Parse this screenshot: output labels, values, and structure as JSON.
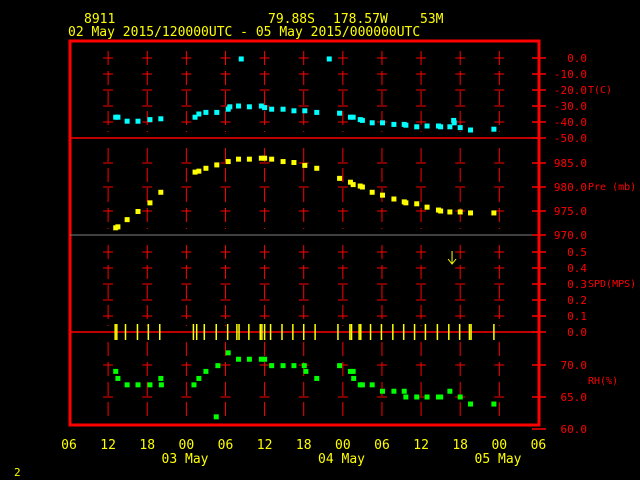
{
  "header": {
    "station": "8911",
    "latitude": "79.88S",
    "longitude": "178.57W",
    "elevation": "53M",
    "period": "02 May 2015/120000UTC - 05 May 2015/000000UTC"
  },
  "footer_label": "2",
  "colors": {
    "frame": "#ff0000",
    "axis_text": "#ffff00",
    "temperature": "#00ffff",
    "pressure": "#ffff00",
    "wind": "#ffff00",
    "humidity": "#00ff00"
  },
  "chart_data": {
    "type": "scatter",
    "x_axis": {
      "range": [
        "2015-05-02T06:00",
        "2015-05-05T06:00"
      ],
      "tick_labels": [
        "06",
        "12",
        "18",
        "00",
        "06",
        "12",
        "18",
        "00",
        "06",
        "12",
        "18",
        "00",
        "06"
      ],
      "date_labels": [
        "03 May",
        "04 May",
        "05 May"
      ],
      "grid": true
    },
    "panels": [
      {
        "key": "temperature",
        "ylabel": "T(C)",
        "ylim": [
          -50,
          0
        ],
        "tick_labels": [
          "0.0",
          "-10.0",
          "-20.0",
          "-30.0",
          "-40.0",
          "-50.0"
        ],
        "points": [
          [
            "2015-05-02T13:10",
            -37
          ],
          [
            "2015-05-02T13:30",
            -37
          ],
          [
            "2015-05-02T14:55",
            -39.5
          ],
          [
            "2015-05-02T16:35",
            -39.5
          ],
          [
            "2015-05-02T18:25",
            -38.5
          ],
          [
            "2015-05-02T20:05",
            -38
          ],
          [
            "2015-05-03T01:20",
            -37
          ],
          [
            "2015-05-03T01:55",
            -35
          ],
          [
            "2015-05-03T03:00",
            -34
          ],
          [
            "2015-05-03T04:40",
            -34
          ],
          [
            "2015-05-03T06:25",
            -32
          ],
          [
            "2015-05-03T06:40",
            -30.5
          ],
          [
            "2015-05-03T08:00",
            -30
          ],
          [
            "2015-05-03T08:25",
            -0.6
          ],
          [
            "2015-05-03T09:40",
            -30.5
          ],
          [
            "2015-05-03T11:30",
            -30
          ],
          [
            "2015-05-03T12:00",
            -31
          ],
          [
            "2015-05-03T13:05",
            -32
          ],
          [
            "2015-05-03T14:50",
            -32
          ],
          [
            "2015-05-03T16:30",
            -33
          ],
          [
            "2015-05-03T18:10",
            -33
          ],
          [
            "2015-05-03T20:00",
            -34
          ],
          [
            "2015-05-03T21:55",
            -0.6
          ],
          [
            "2015-05-03T23:30",
            -34.5
          ],
          [
            "2015-05-04T01:10",
            -37
          ],
          [
            "2015-05-04T01:35",
            -37
          ],
          [
            "2015-05-04T02:40",
            -38.5
          ],
          [
            "2015-05-04T03:00",
            -39
          ],
          [
            "2015-05-04T04:30",
            -40.5
          ],
          [
            "2015-05-04T06:05",
            -40.5
          ],
          [
            "2015-05-04T07:50",
            -41.5
          ],
          [
            "2015-05-04T09:25",
            -41.5
          ],
          [
            "2015-05-04T09:40",
            -42
          ],
          [
            "2015-05-04T11:20",
            -43
          ],
          [
            "2015-05-04T12:55",
            -42.5
          ],
          [
            "2015-05-04T14:40",
            -42.5
          ],
          [
            "2015-05-04T15:00",
            -43
          ],
          [
            "2015-05-04T16:25",
            -43
          ],
          [
            "2015-05-04T17:00",
            -39
          ],
          [
            "2015-05-04T17:05",
            -40.5
          ],
          [
            "2015-05-04T18:00",
            -43.5
          ],
          [
            "2015-05-04T19:35",
            -45
          ],
          [
            "2015-05-04T23:10",
            -44.5
          ]
        ]
      },
      {
        "key": "pressure",
        "ylabel": "Pre (mb)",
        "ylim": [
          970,
          990
        ],
        "tick_labels": [
          "985.0",
          "980.0",
          "975.0",
          "970.0"
        ],
        "points": [
          [
            "2015-05-02T13:10",
            971.5
          ],
          [
            "2015-05-02T13:30",
            971.7
          ],
          [
            "2015-05-02T14:55",
            973.2
          ],
          [
            "2015-05-02T16:35",
            974.9
          ],
          [
            "2015-05-02T18:25",
            976.7
          ],
          [
            "2015-05-02T20:05",
            978.9
          ],
          [
            "2015-05-03T01:20",
            983.1
          ],
          [
            "2015-05-03T01:55",
            983.3
          ],
          [
            "2015-05-03T03:00",
            983.9
          ],
          [
            "2015-05-03T04:40",
            984.6
          ],
          [
            "2015-05-03T06:25",
            985.3
          ],
          [
            "2015-05-03T08:00",
            985.8
          ],
          [
            "2015-05-03T09:40",
            985.8
          ],
          [
            "2015-05-03T11:30",
            986
          ],
          [
            "2015-05-03T12:00",
            986
          ],
          [
            "2015-05-03T13:05",
            985.8
          ],
          [
            "2015-05-03T14:50",
            985.3
          ],
          [
            "2015-05-03T16:30",
            985.1
          ],
          [
            "2015-05-03T18:10",
            984.5
          ],
          [
            "2015-05-03T20:00",
            983.9
          ],
          [
            "2015-05-03T23:30",
            981.8
          ],
          [
            "2015-05-04T01:10",
            981
          ],
          [
            "2015-05-04T01:35",
            980.5
          ],
          [
            "2015-05-04T02:40",
            980.2
          ],
          [
            "2015-05-04T03:00",
            980
          ],
          [
            "2015-05-04T04:30",
            978.9
          ],
          [
            "2015-05-04T06:05",
            978.3
          ],
          [
            "2015-05-04T07:50",
            977.5
          ],
          [
            "2015-05-04T09:25",
            976.9
          ],
          [
            "2015-05-04T09:40",
            976.7
          ],
          [
            "2015-05-04T11:20",
            976.5
          ],
          [
            "2015-05-04T12:55",
            975.8
          ],
          [
            "2015-05-04T14:40",
            975.2
          ],
          [
            "2015-05-04T15:00",
            975
          ],
          [
            "2015-05-04T16:25",
            974.8
          ],
          [
            "2015-05-04T18:00",
            974.8
          ],
          [
            "2015-05-04T19:35",
            974.6
          ],
          [
            "2015-05-04T23:10",
            974.6
          ]
        ]
      },
      {
        "key": "wind",
        "ylabel": "SPD(MPS)",
        "ylim": [
          0,
          0.6
        ],
        "tick_labels": [
          "0.5",
          "0.4",
          "0.3",
          "0.2",
          "0.1",
          "0.0"
        ],
        "points": [
          [
            "2015-05-02T13:05",
            0
          ],
          [
            "2015-05-02T13:20",
            0
          ],
          [
            "2015-05-02T14:40",
            0
          ],
          [
            "2015-05-02T16:30",
            0
          ],
          [
            "2015-05-02T18:10",
            0
          ],
          [
            "2015-05-02T19:55",
            0
          ],
          [
            "2015-05-03T01:05",
            0
          ],
          [
            "2015-05-03T01:35",
            0
          ],
          [
            "2015-05-03T02:45",
            0
          ],
          [
            "2015-05-03T04:35",
            0
          ],
          [
            "2015-05-03T06:20",
            0
          ],
          [
            "2015-05-03T07:45",
            0
          ],
          [
            "2015-05-03T08:05",
            0
          ],
          [
            "2015-05-03T09:35",
            0
          ],
          [
            "2015-05-03T11:20",
            0
          ],
          [
            "2015-05-03T11:35",
            0
          ],
          [
            "2015-05-03T12:00",
            0
          ],
          [
            "2015-05-03T12:55",
            0
          ],
          [
            "2015-05-03T14:40",
            0
          ],
          [
            "2015-05-03T16:20",
            0
          ],
          [
            "2015-05-03T18:00",
            0
          ],
          [
            "2015-05-03T19:45",
            0
          ],
          [
            "2015-05-03T23:15",
            0
          ],
          [
            "2015-05-04T01:05",
            0
          ],
          [
            "2015-05-04T01:20",
            0
          ],
          [
            "2015-05-04T02:30",
            0
          ],
          [
            "2015-05-04T02:45",
            0
          ],
          [
            "2015-05-04T04:15",
            0
          ],
          [
            "2015-05-04T05:55",
            0
          ],
          [
            "2015-05-04T07:40",
            0
          ],
          [
            "2015-05-04T09:20",
            0
          ],
          [
            "2015-05-04T11:00",
            0
          ],
          [
            "2015-05-04T12:40",
            0
          ],
          [
            "2015-05-04T14:30",
            0
          ],
          [
            "2015-05-04T16:15",
            0
          ],
          [
            "2015-05-04T17:55",
            0
          ],
          [
            "2015-05-04T19:25",
            0
          ],
          [
            "2015-05-04T19:40",
            0
          ],
          [
            "2015-05-04T23:10",
            0
          ]
        ],
        "direction_arrow": {
          "time": "2015-05-04T16:45",
          "direction": "down"
        }
      },
      {
        "key": "humidity",
        "ylabel": "RH(%)",
        "ylim": [
          60,
          75
        ],
        "tick_labels": [
          "70.0",
          "65.0",
          "60.0"
        ],
        "points": [
          [
            "2015-05-02T13:10",
            69
          ],
          [
            "2015-05-02T13:30",
            67.9
          ],
          [
            "2015-05-02T14:55",
            66.9
          ],
          [
            "2015-05-02T16:35",
            66.9
          ],
          [
            "2015-05-02T18:25",
            66.9
          ],
          [
            "2015-05-02T20:05",
            67.9
          ],
          [
            "2015-05-02T20:10",
            66.9
          ],
          [
            "2015-05-03T01:10",
            66.9
          ],
          [
            "2015-05-03T01:55",
            67.9
          ],
          [
            "2015-05-03T03:00",
            69
          ],
          [
            "2015-05-03T04:35",
            61.9
          ],
          [
            "2015-05-03T04:50",
            69.9
          ],
          [
            "2015-05-03T06:25",
            71.9
          ],
          [
            "2015-05-03T08:00",
            70.9
          ],
          [
            "2015-05-03T09:40",
            70.9
          ],
          [
            "2015-05-03T11:30",
            70.9
          ],
          [
            "2015-05-03T12:00",
            70.9
          ],
          [
            "2015-05-03T13:05",
            69.9
          ],
          [
            "2015-05-03T14:50",
            69.9
          ],
          [
            "2015-05-03T16:30",
            69.9
          ],
          [
            "2015-05-03T18:05",
            69.9
          ],
          [
            "2015-05-03T18:20",
            69
          ],
          [
            "2015-05-03T20:00",
            67.9
          ],
          [
            "2015-05-03T23:30",
            69.9
          ],
          [
            "2015-05-04T01:10",
            69
          ],
          [
            "2015-05-04T01:35",
            69
          ],
          [
            "2015-05-04T01:40",
            67.9
          ],
          [
            "2015-05-04T02:40",
            66.9
          ],
          [
            "2015-05-04T03:00",
            66.9
          ],
          [
            "2015-05-04T04:30",
            66.9
          ],
          [
            "2015-05-04T06:05",
            65.9
          ],
          [
            "2015-05-04T07:50",
            65.9
          ],
          [
            "2015-05-04T09:25",
            65.9
          ],
          [
            "2015-05-04T09:40",
            65
          ],
          [
            "2015-05-04T11:20",
            65
          ],
          [
            "2015-05-04T12:55",
            65
          ],
          [
            "2015-05-04T14:40",
            65
          ],
          [
            "2015-05-04T15:00",
            65
          ],
          [
            "2015-05-04T16:25",
            65.9
          ],
          [
            "2015-05-04T18:00",
            65
          ],
          [
            "2015-05-04T19:35",
            63.9
          ],
          [
            "2015-05-04T23:10",
            63.9
          ]
        ]
      }
    ]
  }
}
